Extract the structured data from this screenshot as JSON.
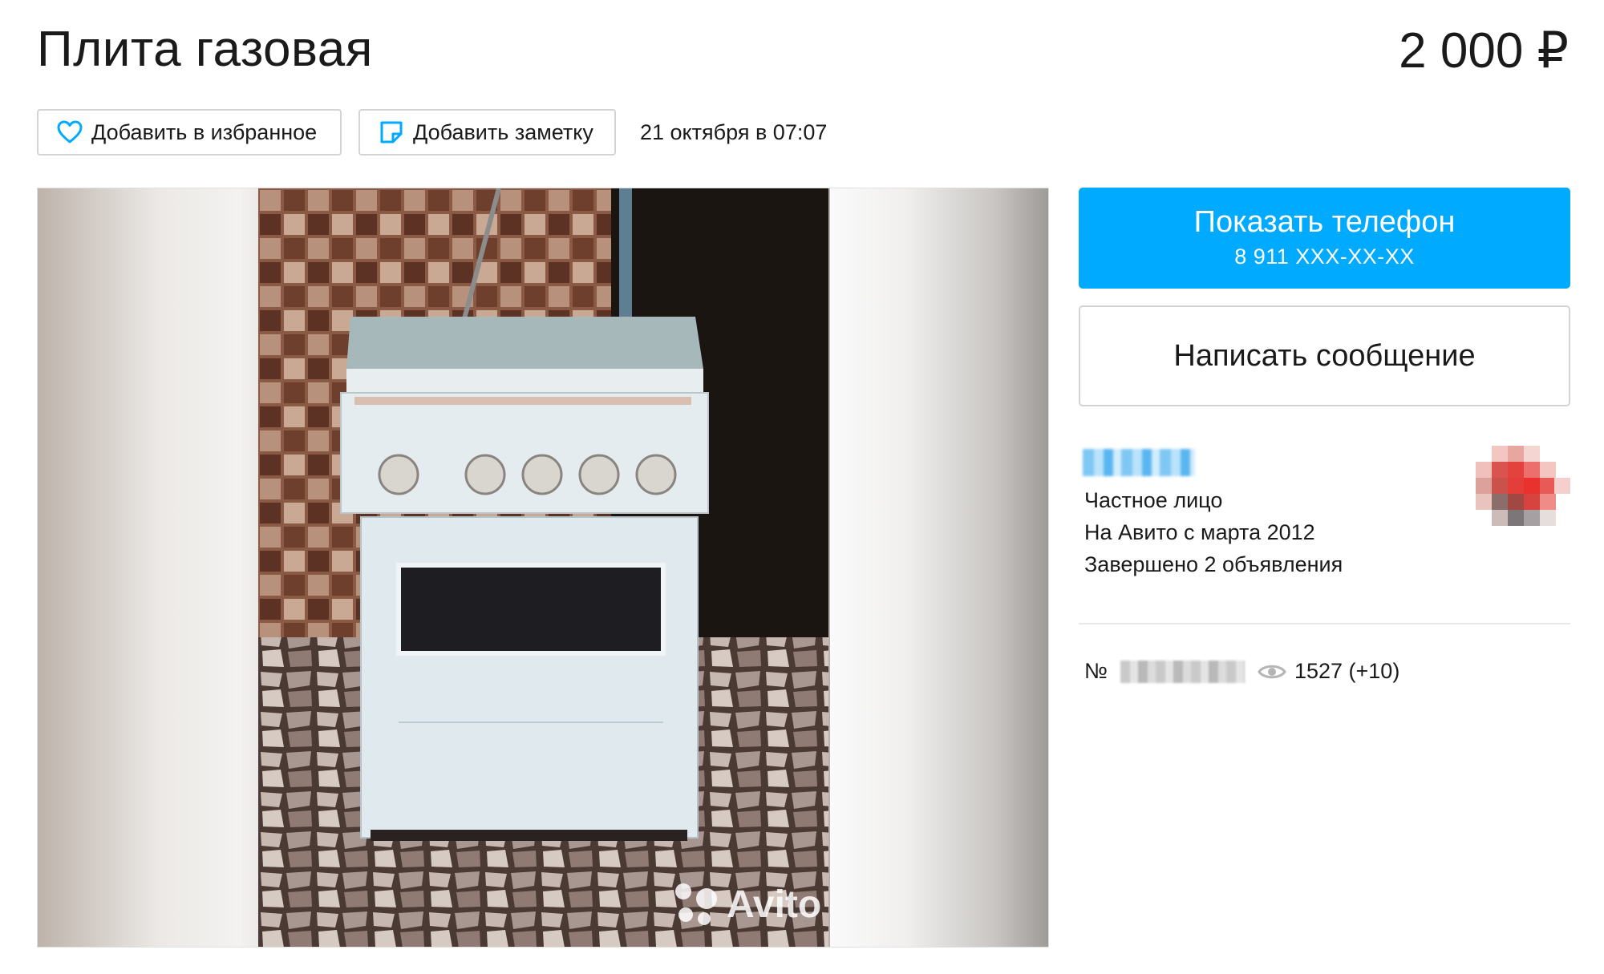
{
  "listing": {
    "title": "Плита газовая",
    "price": "2 000 ₽",
    "date": "21 октября в 07:07"
  },
  "actions": {
    "favorite_label": "Добавить в избранное",
    "note_label": "Добавить заметку"
  },
  "contact": {
    "show_phone_label": "Показать телефон",
    "phone_masked": "8 911 XXX-XX-XX",
    "message_label": "Написать сообщение"
  },
  "seller": {
    "type": "Частное лицо",
    "since": "На Авито с марта 2012",
    "completed": "Завершено 2 объявления"
  },
  "meta": {
    "number_prefix": "№",
    "views": "1527 (+10)"
  },
  "gallery": {
    "watermark": "Avito"
  },
  "colors": {
    "accent": "#00aaff",
    "heart_icon": "#00aaff",
    "border": "#d4d4d4"
  },
  "icons": [
    "heart-icon",
    "note-icon",
    "eye-icon",
    "avito-logo-icon"
  ]
}
